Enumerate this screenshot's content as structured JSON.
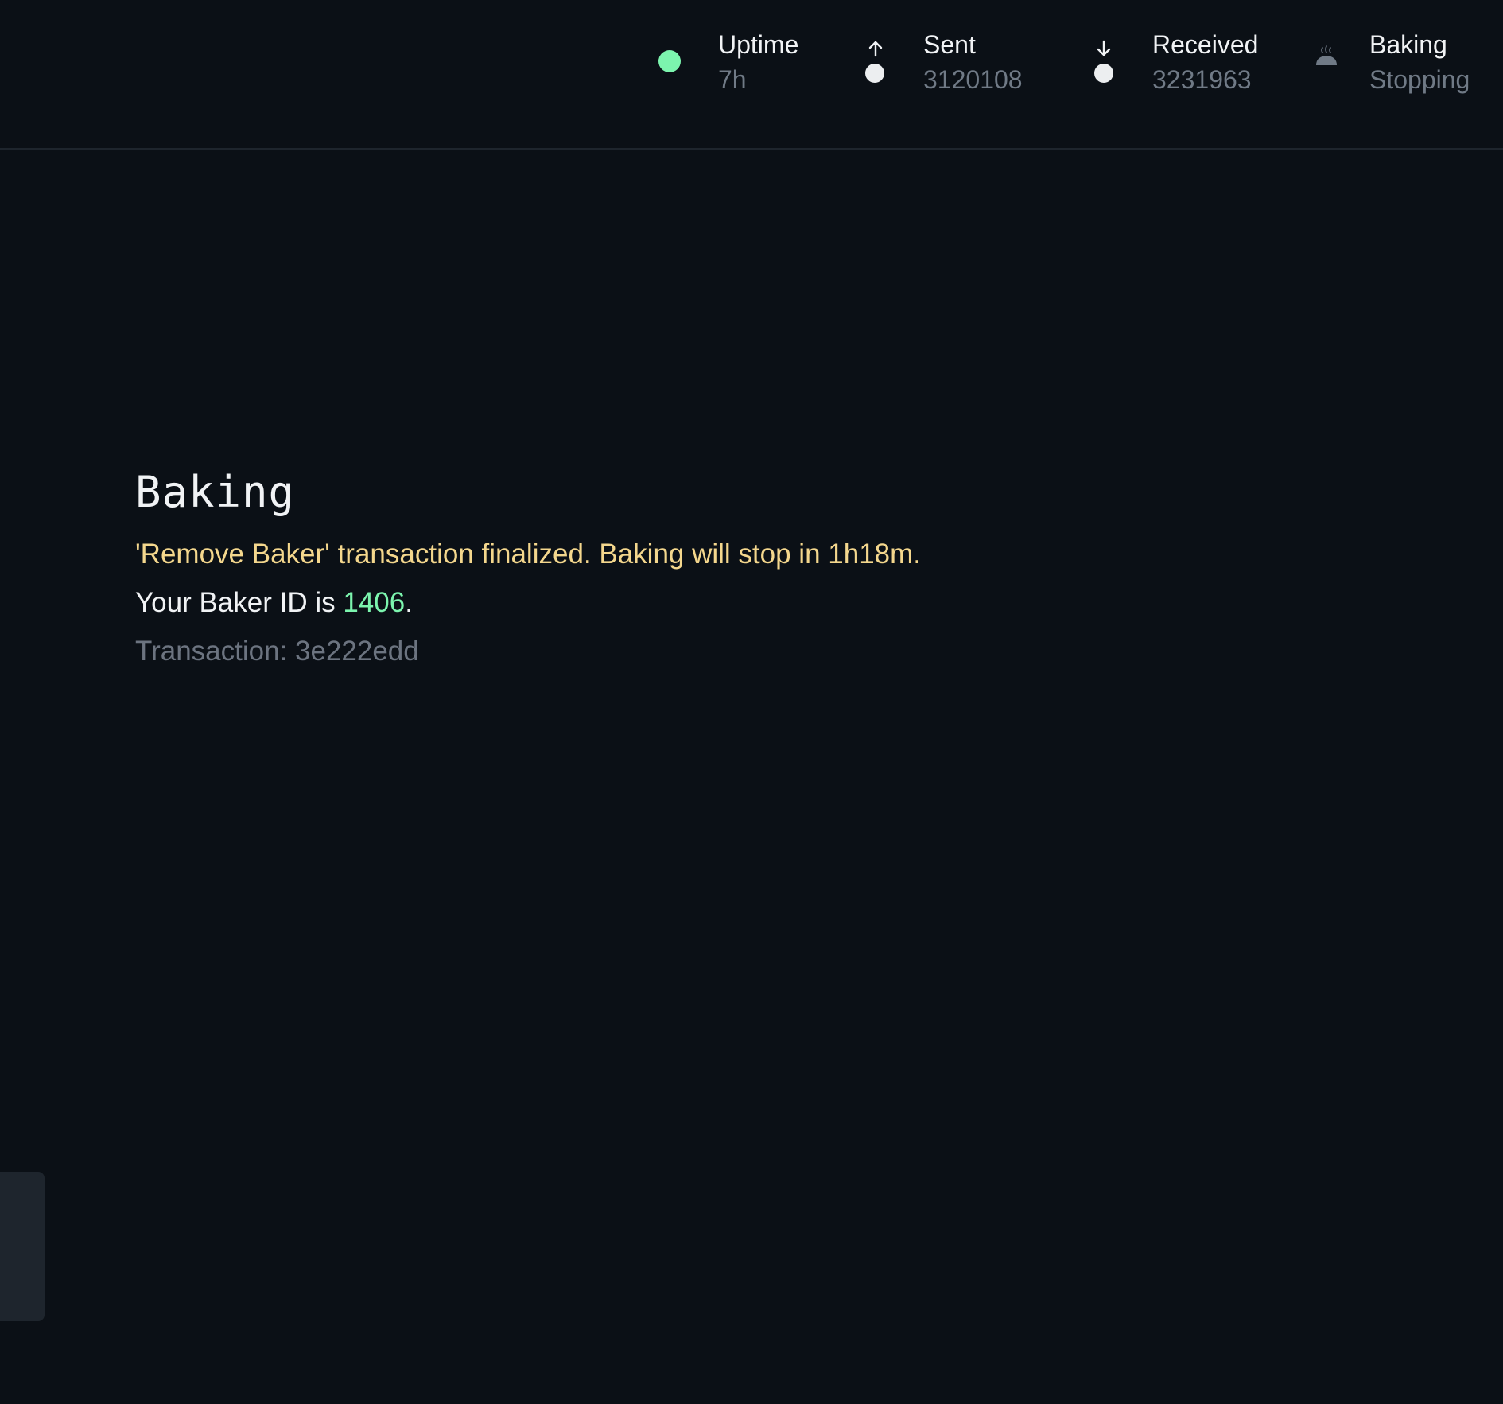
{
  "header": {
    "uptime": {
      "label": "Uptime",
      "value": "7h",
      "icon": "status-dot-icon",
      "color": "#7cf5ae"
    },
    "sent": {
      "label": "Sent",
      "value": "3120108",
      "icon": "arrow-up-icon"
    },
    "received": {
      "label": "Received",
      "value": "3231963",
      "icon": "arrow-down-icon"
    },
    "baking": {
      "label": "Baking",
      "value": "Stopping",
      "icon": "bread-icon"
    }
  },
  "main": {
    "title": "Baking",
    "notice": "'Remove Baker' transaction finalized. Baking will stop in 1h18m.",
    "baker_prefix": "Your Baker ID is ",
    "baker_id": "1406",
    "baker_suffix": ".",
    "transaction": "Transaction: 3e222edd"
  },
  "colors": {
    "background": "#0b1016",
    "accent_green": "#7cf5ae",
    "notice_yellow": "#f4d78d",
    "muted": "#707a86"
  }
}
